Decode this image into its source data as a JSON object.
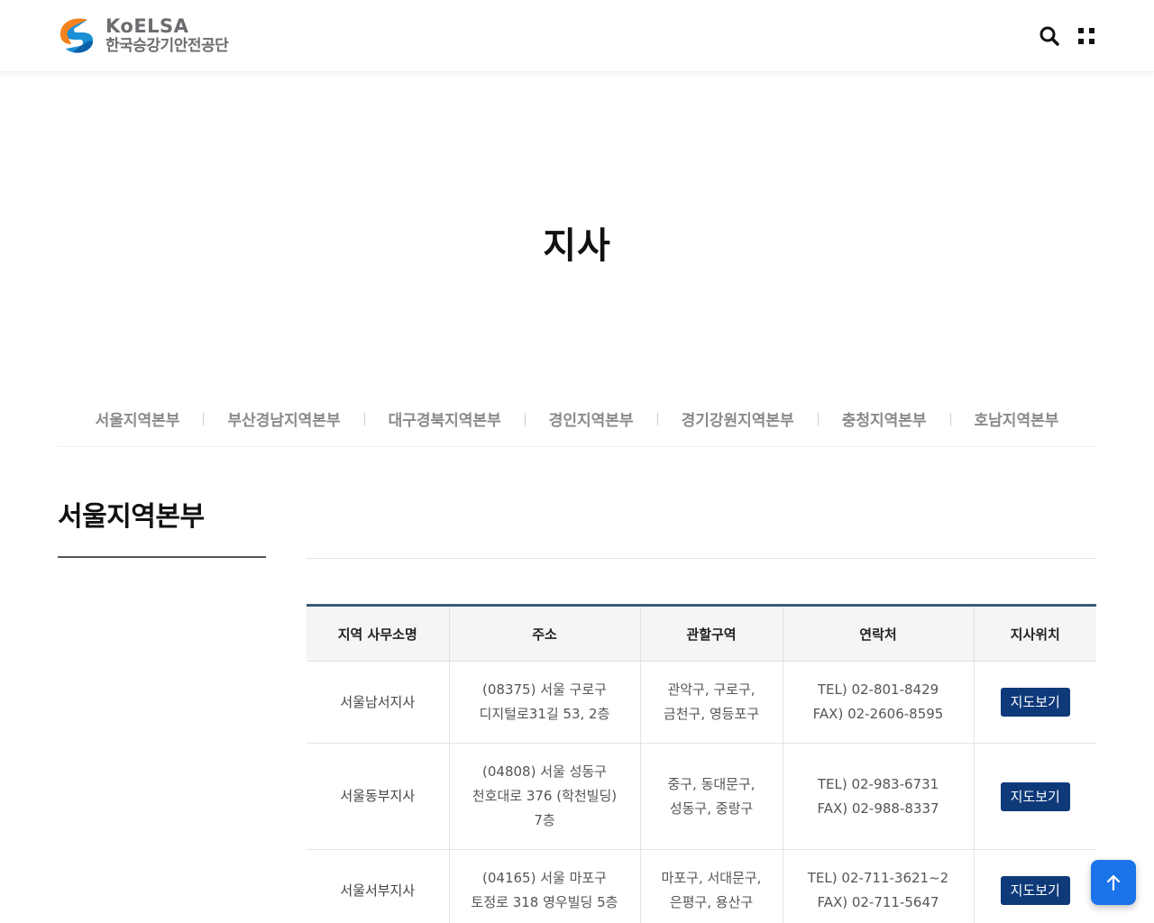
{
  "brand": {
    "name_en": "KoELSA",
    "name_ko": "한국승강기안전공단",
    "colors": {
      "orange": "#f58220",
      "blue": "#1a8fd6",
      "gray": "#6b6d70"
    }
  },
  "header": {
    "search_icon": "search-icon",
    "menu_icon": "grid-menu-icon"
  },
  "page": {
    "title": "지사"
  },
  "tabs": [
    {
      "label": "서울지역본부"
    },
    {
      "label": "부산경남지역본부"
    },
    {
      "label": "대구경북지역본부"
    },
    {
      "label": "경인지역본부"
    },
    {
      "label": "경기강원지역본부"
    },
    {
      "label": "충청지역본부"
    },
    {
      "label": "호남지역본부"
    }
  ],
  "section": {
    "title": "서울지역본부"
  },
  "table": {
    "headers": [
      "지역 사무소명",
      "주소",
      "관할구역",
      "연락처",
      "지사위치"
    ],
    "rows": [
      {
        "name": "서울남서지사",
        "address": [
          "(08375) 서울 구로구",
          "디지털로31길 53, 2층"
        ],
        "area": [
          "관악구, 구로구,",
          "금천구, 영등포구"
        ],
        "contact": [
          "TEL) 02-801-8429",
          "FAX) 02-2606-8595"
        ],
        "map_label": "지도보기"
      },
      {
        "name": "서울동부지사",
        "address": [
          "(04808) 서울 성동구",
          "천호대로 376 (학천빌딩)",
          "7층"
        ],
        "area": [
          "중구, 동대문구,",
          "성동구, 중랑구"
        ],
        "contact": [
          "TEL) 02-983-6731",
          "FAX) 02-988-8337"
        ],
        "map_label": "지도보기"
      },
      {
        "name": "서울서부지사",
        "address": [
          "(04165) 서울 마포구",
          "토정로 318 영우빌딩 5층"
        ],
        "area": [
          "마포구, 서대문구,",
          "은평구, 용산구"
        ],
        "contact": [
          "TEL) 02-711-3621~2",
          "FAX) 02-711-5647"
        ],
        "map_label": "지도보기"
      }
    ]
  },
  "accent": {
    "table_top": "#3d5a78",
    "map_button": "#0f3a7a",
    "top_button": "#1a73e8"
  }
}
